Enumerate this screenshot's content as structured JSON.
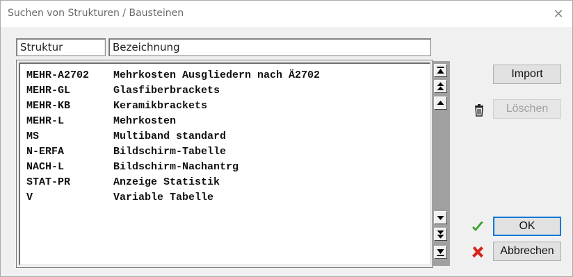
{
  "window": {
    "title": "Suchen von Strukturen / Bausteinen",
    "close_symbol": "✕"
  },
  "columns": {
    "struktur": "Struktur",
    "bezeichnung": "Bezeichnung"
  },
  "rows": [
    {
      "code": "MEHR-A2702",
      "name": "Mehrkosten Ausgliedern nach Ä2702"
    },
    {
      "code": "MEHR-GL",
      "name": "Glasfiberbrackets"
    },
    {
      "code": "MEHR-KB",
      "name": "Keramikbrackets"
    },
    {
      "code": "MEHR-L",
      "name": "Mehrkosten"
    },
    {
      "code": "MS",
      "name": "Multiband standard"
    },
    {
      "code": "N-ERFA",
      "name": "Bildschirm-Tabelle"
    },
    {
      "code": "NACH-L",
      "name": "Bildschirm-Nachantrg"
    },
    {
      "code": "STAT-PR",
      "name": "Anzeige Statistik"
    },
    {
      "code": "V",
      "name": "Variable Tabelle"
    }
  ],
  "buttons": {
    "import": "Import",
    "loeschen": "Löschen",
    "ok": "OK",
    "abbrechen": "Abbrechen"
  },
  "icons": {
    "trash": "trash-icon",
    "check": "check-icon",
    "cross": "cross-icon",
    "scroll_top": "scroll-to-top-icon",
    "page_up": "page-up-icon",
    "line_up": "scroll-up-icon",
    "line_down": "scroll-down-icon",
    "page_down": "page-down-icon",
    "scroll_bottom": "scroll-to-bottom-icon"
  },
  "colors": {
    "scroll_track": "#a0a0a0",
    "ok_focus_border": "#0078d7",
    "check_green": "#3aa12a",
    "cross_red": "#d8231e",
    "disabled_text": "#a0a0a0"
  }
}
